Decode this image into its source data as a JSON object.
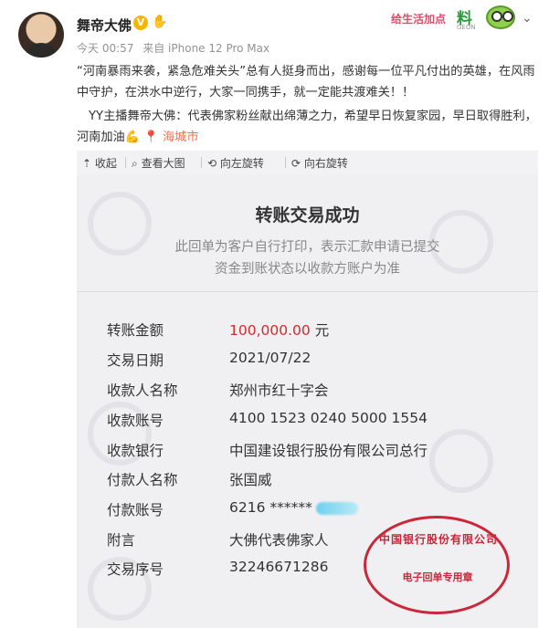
{
  "post": {
    "username": "舞帝大佛",
    "vip_badge": "V",
    "hand_icon": "clap-icon",
    "time": "今天 00:57",
    "source": "来自 iPhone 12 Pro Max",
    "text_p1": "“河南暴雨来袭，紧急危难关头”总有人挺身而出，感谢每一位平凡付出的英雄，在风雨中守护，在洪水中逆行，大家一同携手，就一定能共渡难关！！",
    "text_p2": "YY主播舞帝大佛：代表佛家粉丝献出绵薄之力，希望早日恢复家园，早日取得胜利，河南加油",
    "muscle_glyph": "💪",
    "location_icon": "📍",
    "location": "海城市"
  },
  "brand": {
    "text": "给生活加点",
    "liao": "料",
    "sub": "GEON"
  },
  "toolbar": {
    "collapse": "收起",
    "view_large": "查看大图",
    "rotate_left": "向左旋转",
    "rotate_right": "向右旋转",
    "collapse_icon": "⇡",
    "view_icon": "⌕",
    "rotate_left_icon": "⟲",
    "rotate_right_icon": "⟳"
  },
  "receipt": {
    "title": "转账交易成功",
    "note_line1": "此回单为客户自行打印，表示汇款申请已提交",
    "note_line2": "资金到账状态以收款方账户为准",
    "rows": [
      {
        "label": "转账金额",
        "value": "100,000.00",
        "unit": "元"
      },
      {
        "label": "交易日期",
        "value": "2021/07/22"
      },
      {
        "label": "收款人名称",
        "value": "郑州市红十字会"
      },
      {
        "label": "收款账号",
        "value": "4100 1523 0240 5000 1554"
      },
      {
        "label": "收款银行",
        "value": "中国建设银行股份有限公司总行"
      },
      {
        "label": "付款人名称",
        "value": "张国威"
      },
      {
        "label": "付款账号",
        "value": "6216 ******"
      },
      {
        "label": "附言",
        "value": "大佛代表佛家人"
      },
      {
        "label": "交易序号",
        "value": "32246671286"
      }
    ],
    "stamp_top": "中国银行股份有限公司",
    "stamp_bottom": "电子回单专用章"
  },
  "colors": {
    "amount": "#d8272a",
    "location": "#eb7350",
    "stamp": "#c8283a"
  }
}
